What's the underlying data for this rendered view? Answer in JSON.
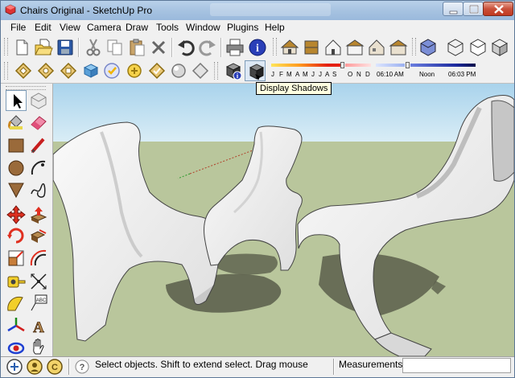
{
  "window": {
    "title": "Chairs Original - SketchUp Pro",
    "controls": {
      "minimize": "minimize-icon",
      "maximize": "maximize-icon",
      "close": "close-icon"
    }
  },
  "menubar": {
    "items": [
      {
        "id": "file",
        "label": "File"
      },
      {
        "id": "edit",
        "label": "Edit"
      },
      {
        "id": "view",
        "label": "View"
      },
      {
        "id": "camera",
        "label": "Camera"
      },
      {
        "id": "draw",
        "label": "Draw"
      },
      {
        "id": "tools",
        "label": "Tools"
      },
      {
        "id": "window",
        "label": "Window"
      },
      {
        "id": "plugins",
        "label": "Plugins"
      },
      {
        "id": "help",
        "label": "Help"
      }
    ]
  },
  "toolbar_standard": {
    "buttons": [
      "new-icon",
      "open-icon",
      "save-icon",
      "cut-icon",
      "copy-icon",
      "paste-icon",
      "erase-icon",
      "undo-icon",
      "redo-icon",
      "print-icon",
      "model-info-icon"
    ]
  },
  "toolbar_views": {
    "buttons": [
      "iso-view-icon",
      "top-view-icon",
      "front-view-icon",
      "right-view-icon",
      "back-view-icon",
      "left-view-icon"
    ]
  },
  "toolbar_styles": {
    "buttons": [
      "xray-icon",
      "back-edges-icon",
      "wireframe-icon",
      "hidden-line-icon",
      "shaded-icon",
      "shaded-textures-icon",
      "monochrome-icon"
    ]
  },
  "toolbar_render": {
    "buttons": [
      "xray-style-icon",
      "hidden-line-style-icon",
      "shaded-style-icon",
      "textured-style-icon",
      "monochrome-style-icon",
      "sandbox-icon",
      "component-icon",
      "sphere-icon",
      "section-icon"
    ]
  },
  "shadows": {
    "settings_icon": "shadow-settings-icon",
    "display_icon": "display-shadows-icon",
    "tooltip": "Display Shadows",
    "months": [
      "J",
      "F",
      "M",
      "A",
      "M",
      "J",
      "J",
      "A",
      "S",
      "O",
      "N",
      "D"
    ],
    "time_start": "06:10 AM",
    "time_mid": "Noon",
    "time_end": "06:03 PM"
  },
  "left_toolbar": {
    "tools": [
      {
        "id": "select",
        "icon": "select-arrow-icon",
        "selected": true
      },
      {
        "id": "make-component",
        "icon": "make-component-icon",
        "selected": false
      },
      {
        "id": "paint-bucket",
        "icon": "paint-bucket-icon",
        "selected": false
      },
      {
        "id": "eraser",
        "icon": "eraser-icon",
        "selected": false
      },
      {
        "id": "rectangle",
        "icon": "rectangle-icon",
        "selected": false
      },
      {
        "id": "line",
        "icon": "pencil-line-icon",
        "selected": false
      },
      {
        "id": "circle",
        "icon": "circle-icon",
        "selected": false
      },
      {
        "id": "arc",
        "icon": "arc-icon",
        "selected": false
      },
      {
        "id": "polygon",
        "icon": "polygon-icon",
        "selected": false
      },
      {
        "id": "freehand",
        "icon": "freehand-icon",
        "selected": false
      },
      {
        "id": "move",
        "icon": "move-icon",
        "selected": false
      },
      {
        "id": "push-pull",
        "icon": "push-pull-icon",
        "selected": false
      },
      {
        "id": "rotate",
        "icon": "rotate-icon",
        "selected": false
      },
      {
        "id": "follow-me",
        "icon": "follow-me-icon",
        "selected": false
      },
      {
        "id": "scale",
        "icon": "scale-icon",
        "selected": false
      },
      {
        "id": "offset",
        "icon": "offset-icon",
        "selected": false
      },
      {
        "id": "tape-measure",
        "icon": "tape-measure-icon",
        "selected": false
      },
      {
        "id": "dimension",
        "icon": "dimension-icon",
        "selected": false
      },
      {
        "id": "protractor",
        "icon": "protractor-icon",
        "selected": false
      },
      {
        "id": "text",
        "icon": "text-icon",
        "selected": false
      },
      {
        "id": "axes",
        "icon": "axes-icon",
        "selected": false
      },
      {
        "id": "3d-text",
        "icon": "3d-text-icon",
        "selected": false
      },
      {
        "id": "orbit",
        "icon": "orbit-icon",
        "selected": false
      },
      {
        "id": "pan",
        "icon": "pan-hand-icon",
        "selected": false
      }
    ]
  },
  "statusbar": {
    "icons": [
      "geolocation-icon",
      "credits-icon",
      "copyright-icon"
    ],
    "message": "Select objects. Shift to extend select. Drag mouse",
    "measurements_label": "Measurements",
    "measurements_value": ""
  },
  "scene": {
    "sky_color": "#bcdff1",
    "ground_color": "#b9c69c",
    "chair_color": "#f7f7f5"
  }
}
